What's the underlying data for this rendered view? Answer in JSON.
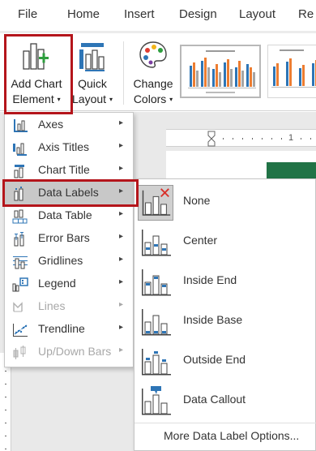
{
  "ribbon_tabs": [
    {
      "label": "File"
    },
    {
      "label": "Home"
    },
    {
      "label": "Insert"
    },
    {
      "label": "Design"
    },
    {
      "label": "Layout"
    },
    {
      "label": "Re"
    }
  ],
  "ribbon": {
    "add_chart_element": {
      "line1": "Add Chart",
      "line2": "Element"
    },
    "quick_layout": {
      "line1": "Quick",
      "line2": "Layout"
    },
    "change_colors": {
      "line1": "Change",
      "line2": "Colors"
    },
    "caret": "▾"
  },
  "ruler": {
    "mark": "1"
  },
  "add_chart_menu": {
    "items": [
      {
        "label": "Axes",
        "enabled": true
      },
      {
        "label": "Axis Titles",
        "enabled": true
      },
      {
        "label": "Chart Title",
        "enabled": true
      },
      {
        "label": "Data Labels",
        "enabled": true,
        "active": true
      },
      {
        "label": "Data Table",
        "enabled": true
      },
      {
        "label": "Error Bars",
        "enabled": true
      },
      {
        "label": "Gridlines",
        "enabled": true
      },
      {
        "label": "Legend",
        "enabled": true
      },
      {
        "label": "Lines",
        "enabled": false
      },
      {
        "label": "Trendline",
        "enabled": true
      },
      {
        "label": "Up/Down Bars",
        "enabled": false
      }
    ],
    "arrow": "▸"
  },
  "data_labels_submenu": {
    "items": [
      {
        "label": "None",
        "icon": "data-labels-none-icon",
        "hot": true
      },
      {
        "label": "Center",
        "icon": "data-labels-center-icon"
      },
      {
        "label": "Inside End",
        "icon": "data-labels-inside-end-icon"
      },
      {
        "label": "Inside Base",
        "icon": "data-labels-inside-base-icon"
      },
      {
        "label": "Outside End",
        "icon": "data-labels-outside-end-icon"
      },
      {
        "label": "Data Callout",
        "icon": "data-labels-callout-icon"
      }
    ],
    "more_options": "More Data Label Options..."
  },
  "colors": {
    "accent_red": "#b4151b",
    "menu_hover": "#c8c8c8",
    "icon_blue": "#2e75b6",
    "chart_orange": "#ed7d31",
    "excel_green": "#217346"
  }
}
